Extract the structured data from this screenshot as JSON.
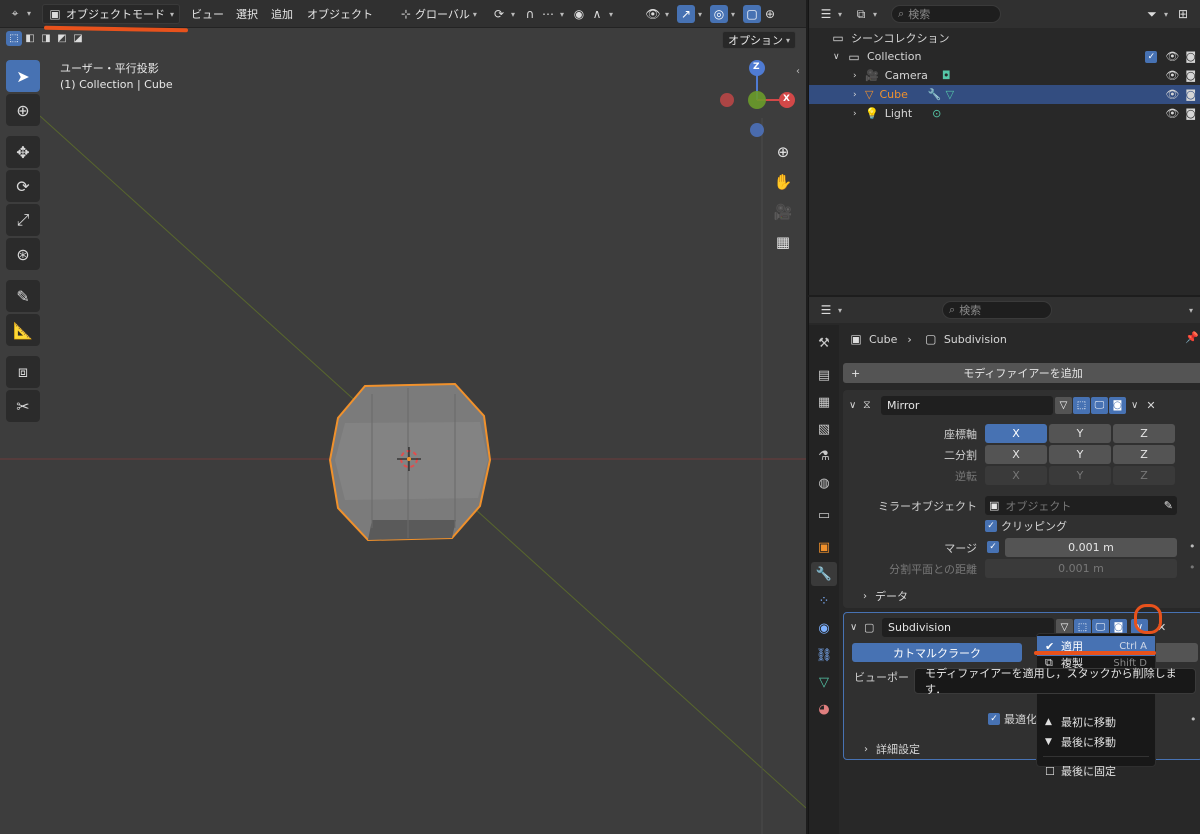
{
  "header": {
    "mode": "オブジェクトモード",
    "menus": [
      "ビュー",
      "選択",
      "追加",
      "オブジェクト"
    ],
    "transform_orientation": "グローバル",
    "options_label": "オプション"
  },
  "viewport": {
    "view_name": "ユーザー・平行投影",
    "view_context": "(1) Collection | Cube",
    "gizmo": {
      "z": "Z",
      "x": "X"
    }
  },
  "outliner": {
    "search_placeholder": "検索",
    "scene_collection": "シーンコレクション",
    "collection": "Collection",
    "items": [
      {
        "label": "Camera",
        "selected": false
      },
      {
        "label": "Cube",
        "selected": true
      },
      {
        "label": "Light",
        "selected": false
      }
    ]
  },
  "properties": {
    "search_placeholder": "検索",
    "breadcrumb_object": "Cube",
    "breadcrumb_modifier": "Subdivision",
    "add_modifier": "モディファイアーを追加",
    "mirror": {
      "name": "Mirror",
      "axis_label": "座標軸",
      "bisect_label": "二分割",
      "flip_label": "逆転",
      "axes": [
        "X",
        "Y",
        "Z"
      ],
      "mirror_object_label": "ミラーオブジェクト",
      "mirror_object_placeholder": "オブジェクト",
      "clipping_label": "クリッピング",
      "merge_label": "マージ",
      "merge_value": "0.001 m",
      "bisect_distance_label": "分割平面との距離",
      "bisect_distance_value": "0.001 m",
      "data_label": "データ"
    },
    "subdivision": {
      "name": "Subdivision",
      "catmull_clark": "カトマルクラーク",
      "viewport_label": "ビューポー",
      "optimal_label": "最適化表",
      "advanced_label": "詳細設定"
    }
  },
  "menu": {
    "apply": "適用",
    "apply_shortcut": "Ctrl A",
    "duplicate_partial": "複製",
    "duplicate_shortcut_partial": "Shift D",
    "move_first": "最初に移動",
    "move_last": "最後に移動",
    "pin_last": "最後に固定"
  },
  "tooltip": "モディファイアーを適用し，スタックから削除します．",
  "colors": {
    "accent": "#4772b3",
    "annotation": "#e8521c",
    "selection_outline": "#f0912c"
  }
}
